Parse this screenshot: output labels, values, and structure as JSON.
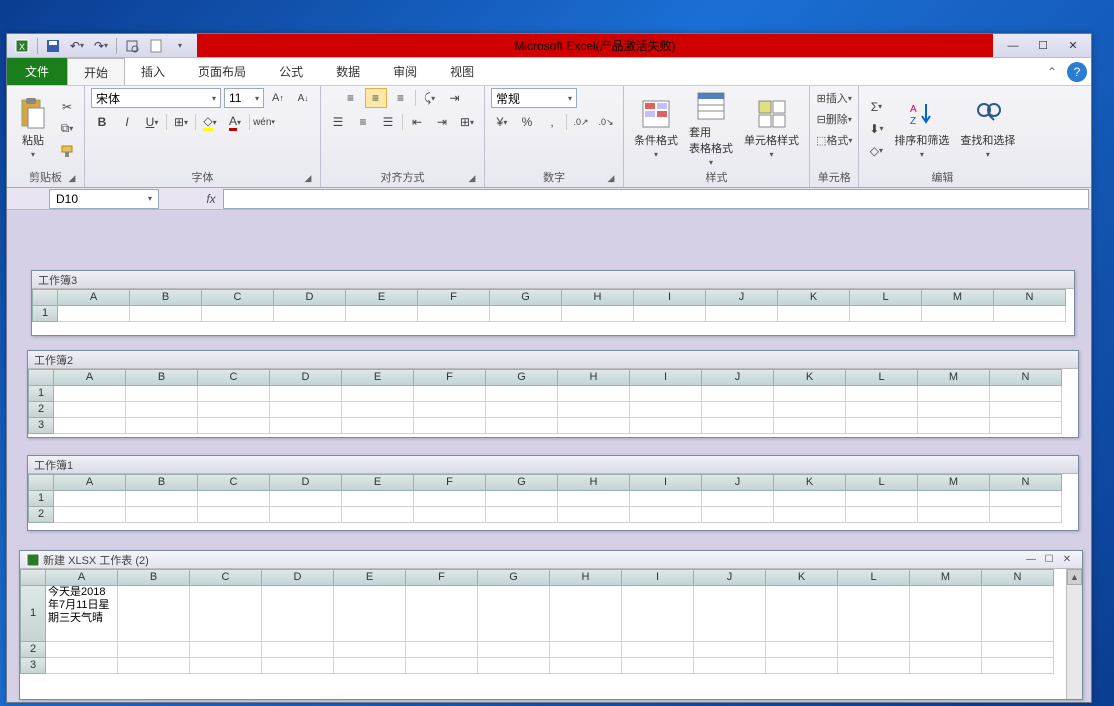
{
  "window": {
    "title": "Microsoft Excel(产品激活失败)"
  },
  "menu": {
    "file": "文件",
    "tabs": [
      "开始",
      "插入",
      "页面布局",
      "公式",
      "数据",
      "审阅",
      "视图"
    ],
    "active": 0
  },
  "ribbon": {
    "clipboard": {
      "label": "剪贴板",
      "paste": "粘贴"
    },
    "font": {
      "label": "字体",
      "name": "宋体",
      "size": "11"
    },
    "alignment": {
      "label": "对齐方式"
    },
    "number": {
      "label": "数字",
      "format": "常规"
    },
    "styles": {
      "label": "样式",
      "cond": "条件格式",
      "table": "套用\n表格格式",
      "cell": "单元格样式"
    },
    "cells": {
      "label": "单元格",
      "insert": "插入",
      "delete": "删除",
      "format": "格式"
    },
    "editing": {
      "label": "编辑",
      "sort": "排序和筛选",
      "find": "查找和选择"
    }
  },
  "namebox": "D10",
  "workbooks": [
    {
      "title": "工作簿3",
      "cols": [
        "A",
        "B",
        "C",
        "D",
        "E",
        "F",
        "G",
        "H",
        "I",
        "J",
        "K",
        "L",
        "M",
        "N"
      ],
      "rows": [
        "1"
      ]
    },
    {
      "title": "工作簿2",
      "cols": [
        "A",
        "B",
        "C",
        "D",
        "E",
        "F",
        "G",
        "H",
        "I",
        "J",
        "K",
        "L",
        "M",
        "N"
      ],
      "rows": [
        "1",
        "2",
        "3"
      ]
    },
    {
      "title": "工作簿1",
      "cols": [
        "A",
        "B",
        "C",
        "D",
        "E",
        "F",
        "G",
        "H",
        "I",
        "J",
        "K",
        "L",
        "M",
        "N"
      ],
      "rows": [
        "1",
        "2"
      ]
    },
    {
      "title": "新建 XLSX 工作表 (2)",
      "cols": [
        "A",
        "B",
        "C",
        "D",
        "E",
        "F",
        "G",
        "H",
        "I",
        "J",
        "K",
        "L",
        "M",
        "N"
      ],
      "rows": [
        "1",
        "2",
        "3"
      ],
      "cells": {
        "A1": "今天是2018年7月11日星期三天气晴"
      }
    }
  ]
}
